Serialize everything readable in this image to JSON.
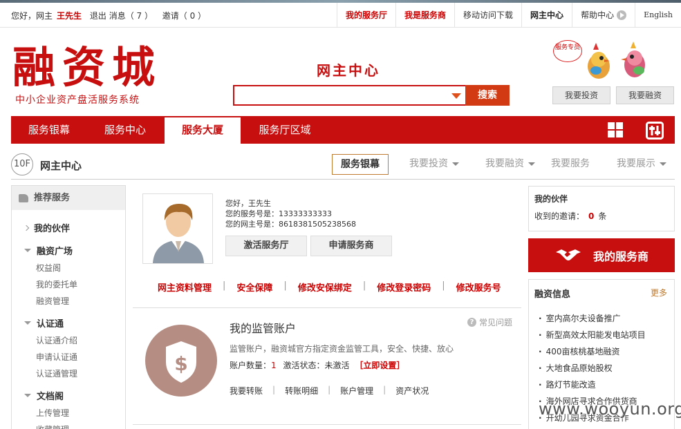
{
  "topbar": {
    "greeting": "您好，网主",
    "username": "王先生",
    "logout": "退出",
    "messages": "消息（ 7 ）",
    "invites": "邀请（ 0 ）",
    "links": [
      "我的服务厅",
      "我是服务商",
      "移动访问下载",
      "网主中心",
      "帮助中心",
      "English"
    ]
  },
  "header": {
    "logo_title": "融资城",
    "logo_subtitle": "中小企业资产盘活服务系统",
    "center_title": "网主中心",
    "search_placeholder": "",
    "search_button": "搜索",
    "mascot_badge": "服务专员",
    "invest_button": "我要投资",
    "finance_button": "我要融资"
  },
  "nav": {
    "items": [
      "服务银幕",
      "服务中心",
      "服务大厦",
      "服务厅区域"
    ],
    "active_index": 2
  },
  "floor": {
    "badge": "10F",
    "title": "网主中心",
    "buttons": [
      "服务银幕",
      "我要投资",
      "我要融资",
      "我要服务",
      "我要展示"
    ]
  },
  "sidebar": {
    "header": "推荐服务",
    "groups": [
      {
        "title": "我的伙伴",
        "items": []
      },
      {
        "title": "融资广场",
        "items": [
          "权益阁",
          "我的委托单",
          "融资管理"
        ]
      },
      {
        "title": "认证通",
        "items": [
          "认证通介绍",
          "申请认证通",
          "认证通管理"
        ]
      },
      {
        "title": "文档阁",
        "items": [
          "上传管理",
          "收藏管理"
        ]
      }
    ]
  },
  "profile": {
    "hello": "您好，王先生",
    "service_no": "您的服务号是：13333333333",
    "owner_no": "您的网主号是：8618381505238568",
    "activate_button": "激活服务厅",
    "apply_button": "申请服务商",
    "links": [
      "网主资料管理",
      "安全保障",
      "修改安保绑定",
      "修改登录密码",
      "修改服务号"
    ]
  },
  "account": {
    "title": "我的监管账户",
    "faq": "常见问题",
    "desc": "监管账户，融资城官方指定资金监管工具，安全、快捷、放心",
    "count_label": "账户数量：",
    "count": "1",
    "status_label": "激活状态：未激活",
    "set_link": "［立即设置］",
    "links": [
      "我要转账",
      "转账明细",
      "账户管理",
      "资产状况"
    ]
  },
  "right": {
    "partner_title": "我的伙伴",
    "partner_prefix": "收到的邀请：",
    "partner_count": "0",
    "partner_suffix": "条",
    "provider_button": "我的服务商",
    "finance_title": "融资信息",
    "more": "更多",
    "finance_items": [
      "室内高尔夫设备推广",
      "新型高效太阳能发电站项目",
      "400亩核桃基地融资",
      "大地食品原始股权",
      "路灯节能改造",
      "海外网店寻求合作供货商",
      "开幼儿园寻求资金合作"
    ]
  },
  "watermark": "www.wooyun.org",
  "colors": {
    "brand_red": "#c80f10",
    "accent_orange": "#d23a14",
    "gold": "#c07a2f"
  }
}
